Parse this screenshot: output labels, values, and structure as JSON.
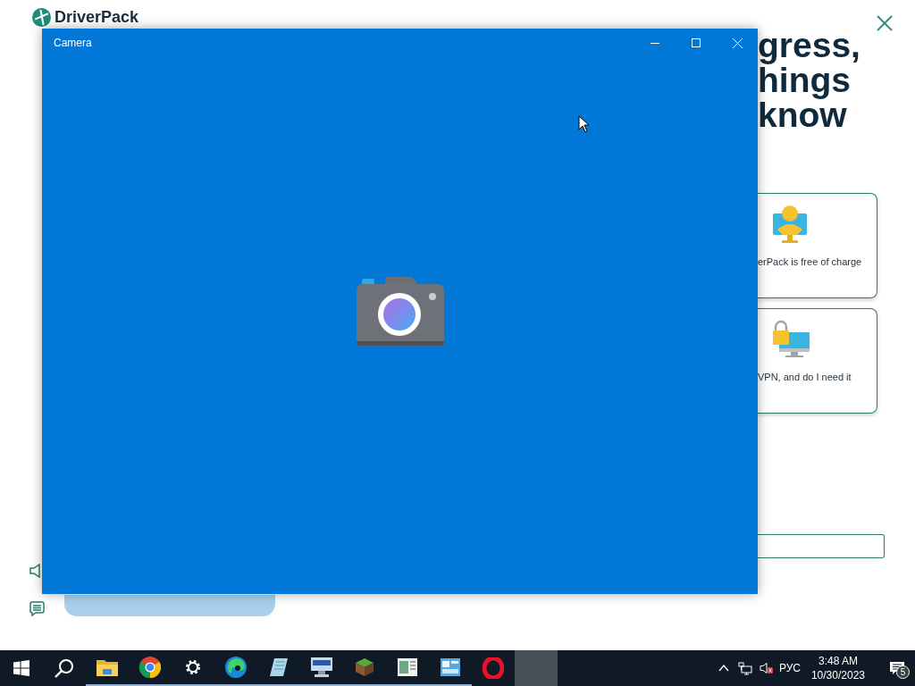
{
  "background_app": {
    "logo": "DriverPack",
    "heading_lines": [
      "gress,",
      "hings",
      "know"
    ],
    "cards": [
      {
        "kind": "payment",
        "text": "erPack is free of charge"
      },
      {
        "kind": "vpn",
        "text": "VPN, and do I need it"
      }
    ]
  },
  "camera_window": {
    "title": "Camera"
  },
  "taskbar": {
    "apps": [
      {
        "kind": "explorer",
        "running": true,
        "selected": false
      },
      {
        "kind": "chrome",
        "running": true,
        "selected": false
      },
      {
        "kind": "settings",
        "running": true,
        "selected": false
      },
      {
        "kind": "edge",
        "running": true,
        "selected": false
      },
      {
        "kind": "notepad",
        "running": true,
        "selected": false
      },
      {
        "kind": "computer",
        "running": true,
        "selected": false
      },
      {
        "kind": "minecraft",
        "running": true,
        "selected": false
      },
      {
        "kind": "document",
        "running": true,
        "selected": false
      },
      {
        "kind": "control",
        "running": true,
        "selected": false
      },
      {
        "kind": "opera",
        "running": false,
        "selected": false
      },
      {
        "kind": "blank",
        "running": false,
        "selected": true
      }
    ],
    "tray": {
      "volume_muted": true,
      "language": "РУС",
      "time": "3:48 AM",
      "date": "10/30/2023",
      "notification_count": "5"
    }
  }
}
